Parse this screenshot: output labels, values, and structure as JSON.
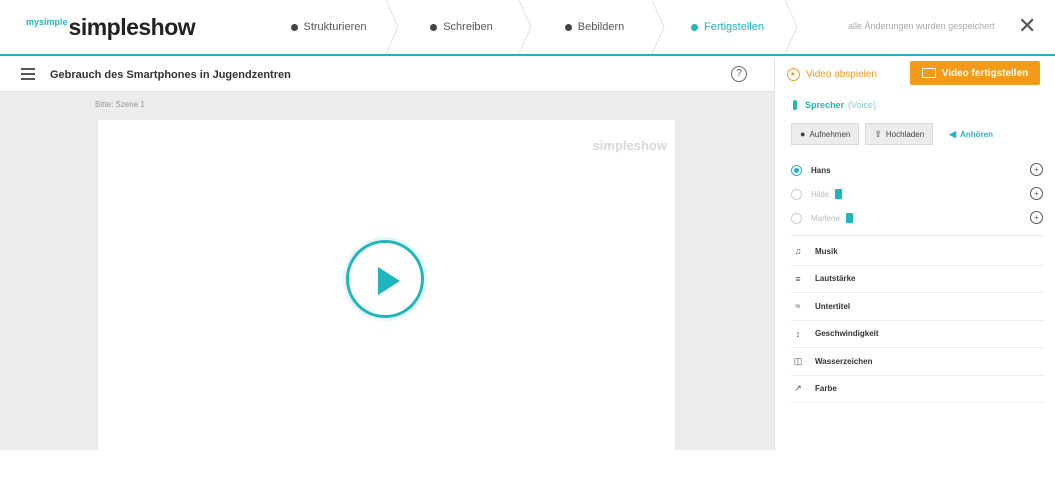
{
  "app": {
    "logo_prefix": "mysimple",
    "logo_text": "simpleshow",
    "saved_note": "alle Änderungen wurden gespeichert",
    "close_glyph": "✕"
  },
  "steps": [
    {
      "label": "Strukturieren",
      "active": false
    },
    {
      "label": "Schreiben",
      "active": false
    },
    {
      "label": "Bebildern",
      "active": false
    },
    {
      "label": "Fertigstellen",
      "active": true
    }
  ],
  "main": {
    "project_title": "Gebrauch des Smartphones in Jugendzentren",
    "help_glyph": "?",
    "slide_label": "Bitte: Szene 1",
    "watermark": "simpleshow"
  },
  "panel": {
    "discard_label": "Video abspielen",
    "finish_label": "Video fertigstellen",
    "speaker_label": "Sprecher",
    "speaker_sub": "(Voice)",
    "record_label": "Aufnehmen",
    "upload_label": "Hochladen",
    "listen_label": "Anhören",
    "voices": [
      {
        "name": "Hans",
        "selected": true,
        "badge": false
      },
      {
        "name": "Hilde",
        "selected": false,
        "badge": true
      },
      {
        "name": "Marlene",
        "selected": false,
        "badge": true
      }
    ],
    "settings": [
      {
        "icon": "music-icon",
        "glyph": "♫",
        "label": "Musik"
      },
      {
        "icon": "volume-icon",
        "glyph": "≡",
        "label": "Lautstärke"
      },
      {
        "icon": "subtitle-icon",
        "glyph": "≈",
        "label": "Untertitel"
      },
      {
        "icon": "speed-icon",
        "glyph": "↕",
        "label": "Geschwindigkeit"
      },
      {
        "icon": "watermark-icon",
        "glyph": "◫",
        "label": "Wasserzeichen"
      },
      {
        "icon": "color-icon",
        "glyph": "↗",
        "label": "Farbe"
      }
    ]
  },
  "colors": {
    "accent": "#1fb5be",
    "orange": "#f39a1b",
    "canvas_bg": "#ececec"
  }
}
